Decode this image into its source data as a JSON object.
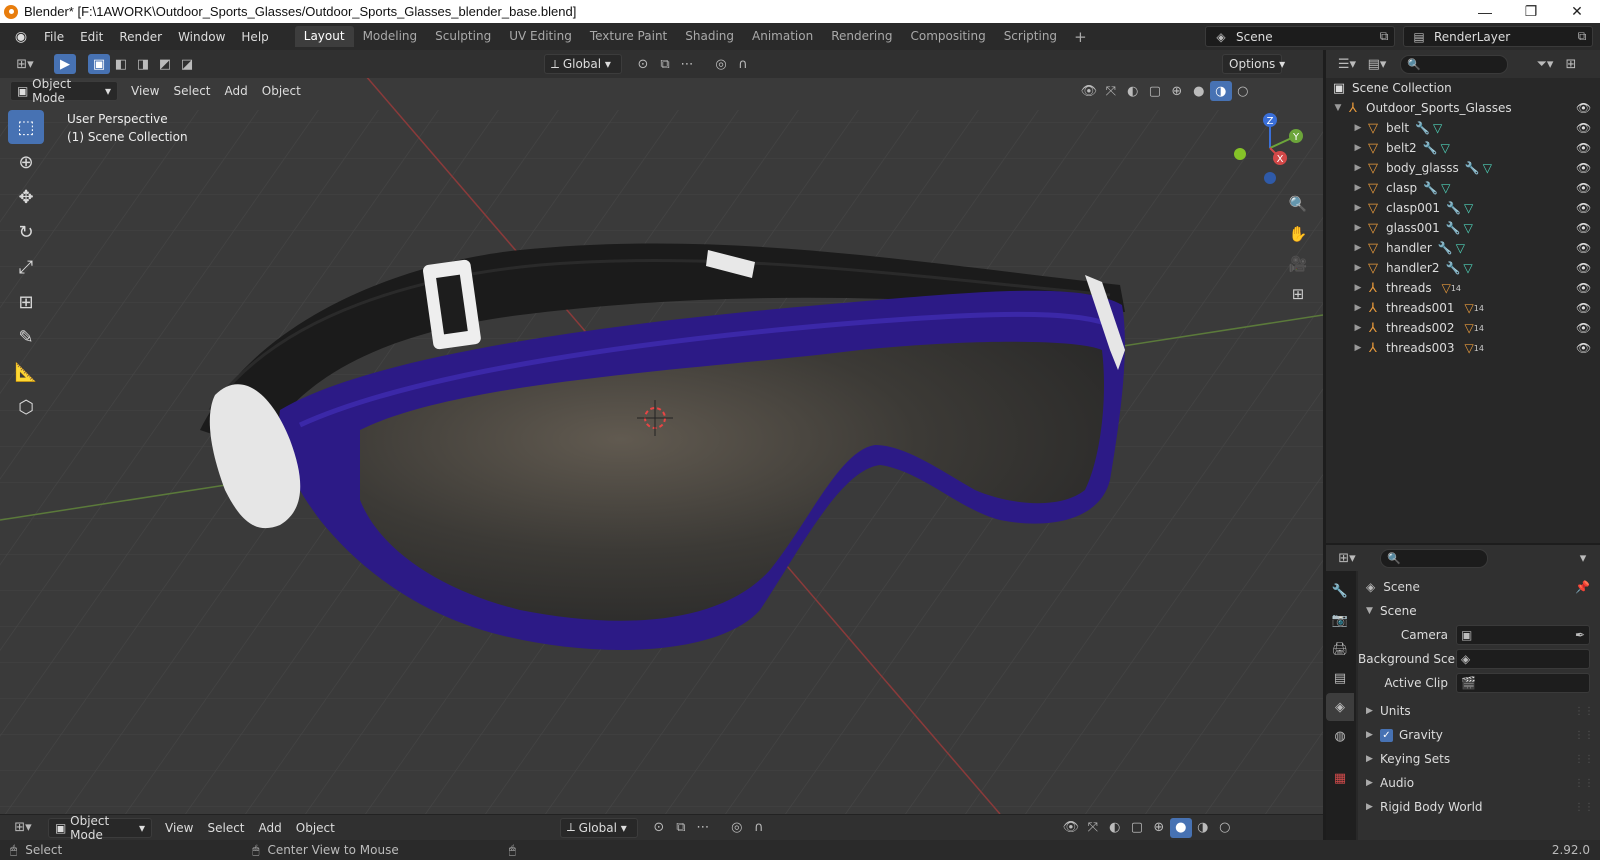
{
  "window": {
    "title": "Blender* [F:\\1AWORK\\Outdoor_Sports_Glasses/Outdoor_Sports_Glasses_blender_base.blend]",
    "min": "—",
    "restore": "❐",
    "close": "✕"
  },
  "menus": [
    "File",
    "Edit",
    "Render",
    "Window",
    "Help"
  ],
  "workspaces": [
    "Layout",
    "Modeling",
    "Sculpting",
    "UV Editing",
    "Texture Paint",
    "Shading",
    "Animation",
    "Rendering",
    "Compositing",
    "Scripting"
  ],
  "active_workspace": "Layout",
  "scene_selector": "Scene",
  "layer_selector": "RenderLayer",
  "tool_header": {
    "transform_orientation": "Global",
    "options_label": "Options"
  },
  "viewport_header": {
    "mode": "Object Mode",
    "menus": [
      "View",
      "Select",
      "Add",
      "Object"
    ]
  },
  "viewport": {
    "perspective_label": "User Perspective",
    "collection_label": "(1) Scene Collection",
    "gizmo": {
      "x": "X",
      "y": "Y",
      "z": "Z"
    }
  },
  "bottom_header": {
    "mode": "Object Mode",
    "menus": [
      "View",
      "Select",
      "Add",
      "Object"
    ],
    "transform_orientation": "Global"
  },
  "outliner": {
    "root": "Scene Collection",
    "collection": "Outdoor_Sports_Glasses",
    "items": [
      {
        "name": "belt",
        "type": "mesh"
      },
      {
        "name": "belt2",
        "type": "mesh"
      },
      {
        "name": "body_glasss",
        "type": "mesh"
      },
      {
        "name": "clasp",
        "type": "mesh"
      },
      {
        "name": "clasp001",
        "type": "mesh"
      },
      {
        "name": "glass001",
        "type": "mesh"
      },
      {
        "name": "handler",
        "type": "mesh"
      },
      {
        "name": "handler2",
        "type": "mesh"
      },
      {
        "name": "threads",
        "type": "empty",
        "badge": "14"
      },
      {
        "name": "threads001",
        "type": "empty",
        "badge": "14"
      },
      {
        "name": "threads002",
        "type": "empty",
        "badge": "14"
      },
      {
        "name": "threads003",
        "type": "empty",
        "badge": "14"
      }
    ]
  },
  "properties": {
    "context": "Scene",
    "panel_title": "Scene",
    "fields": [
      {
        "label": "Camera",
        "value": ""
      },
      {
        "label": "Background Sce...",
        "value": ""
      },
      {
        "label": "Active Clip",
        "value": ""
      }
    ],
    "sections": [
      {
        "label": "Units",
        "checkbox": false
      },
      {
        "label": "Gravity",
        "checkbox": true
      },
      {
        "label": "Keying Sets",
        "checkbox": false
      },
      {
        "label": "Audio",
        "checkbox": false
      },
      {
        "label": "Rigid Body World",
        "checkbox": false
      }
    ]
  },
  "status": {
    "left": "Select",
    "middle": "Center View to Mouse",
    "version": "2.92.0"
  },
  "colors": {
    "accent": "#4772b3",
    "frame_purple": "#2f1a8a",
    "lens": "#3a3530",
    "strap": "#1a1a1a"
  }
}
